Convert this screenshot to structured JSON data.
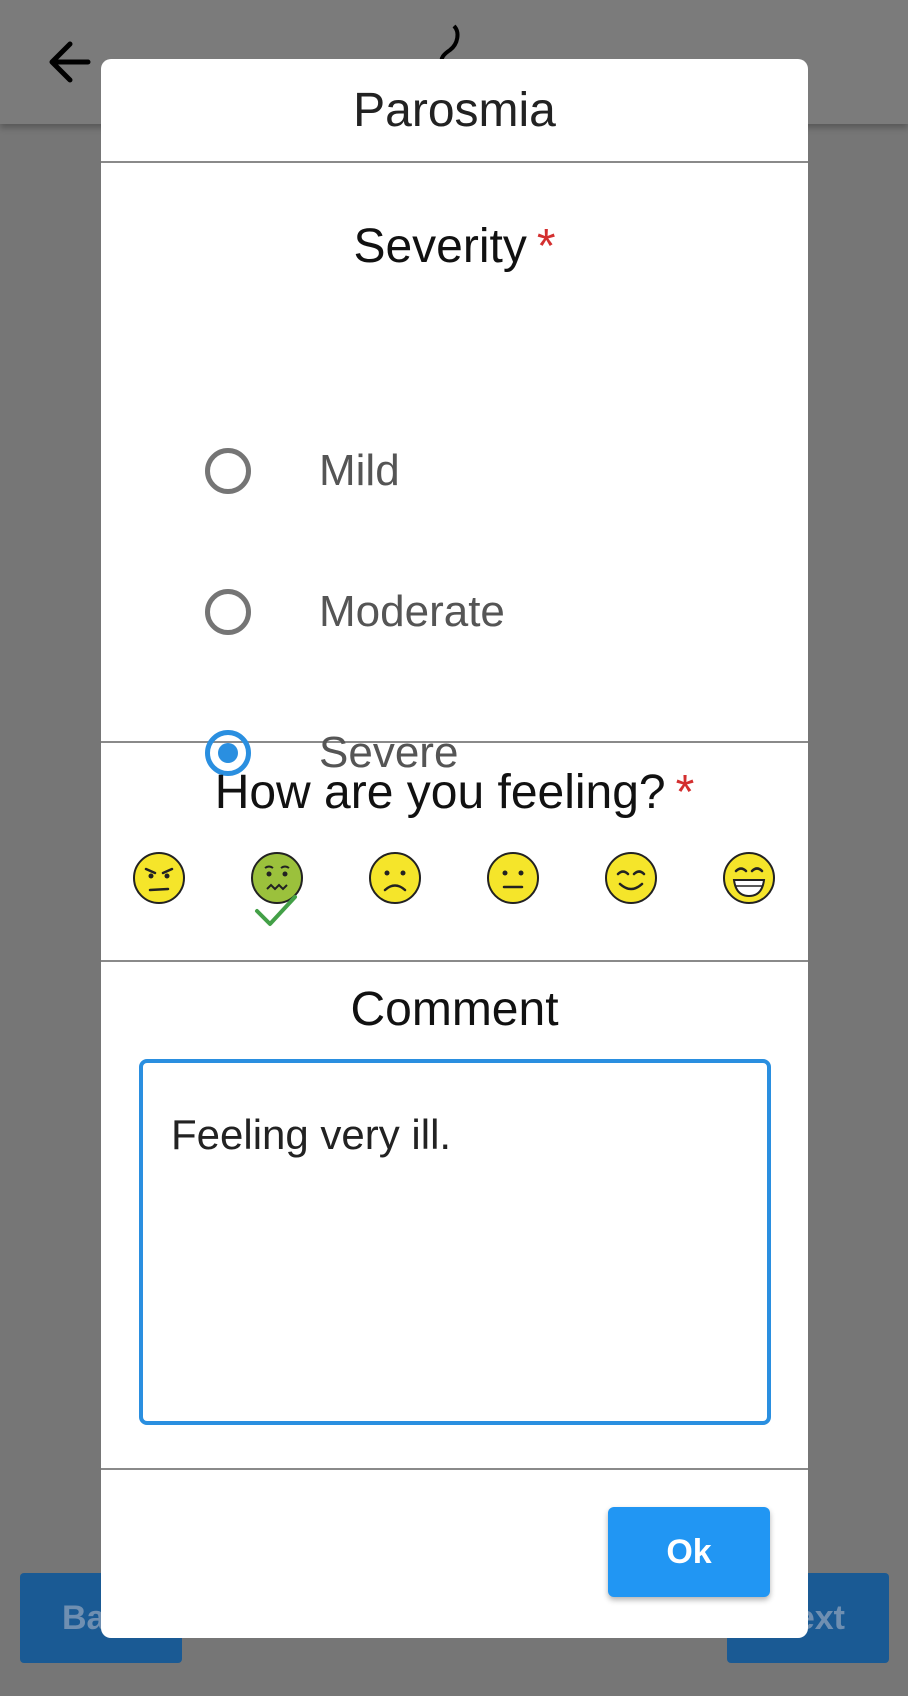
{
  "background": {
    "back_button_label": "Ba",
    "next_button_label": "ext",
    "back_icon": "arrow-left-icon",
    "accent": "#1a5a94"
  },
  "dialog": {
    "title": "Parosmia",
    "severity": {
      "label": "Severity",
      "required_mark": "*",
      "options": [
        {
          "label": "Mild",
          "checked": false
        },
        {
          "label": "Moderate",
          "checked": false
        },
        {
          "label": "Severe",
          "checked": true
        }
      ]
    },
    "feeling": {
      "label": "How are you feeling?",
      "required_mark": "*",
      "emojis": [
        {
          "name": "angry-face-icon",
          "selected": false
        },
        {
          "name": "nauseated-face-icon",
          "selected": true
        },
        {
          "name": "frowning-face-icon",
          "selected": false
        },
        {
          "name": "neutral-face-icon",
          "selected": false
        },
        {
          "name": "smiling-face-icon",
          "selected": false
        },
        {
          "name": "grinning-face-icon",
          "selected": false
        }
      ]
    },
    "comment": {
      "label": "Comment",
      "value": "Feeling very ill."
    },
    "ok_label": "Ok",
    "colors": {
      "primary": "#2196f3",
      "required": "#d32f2f",
      "check": "#43a047"
    }
  }
}
